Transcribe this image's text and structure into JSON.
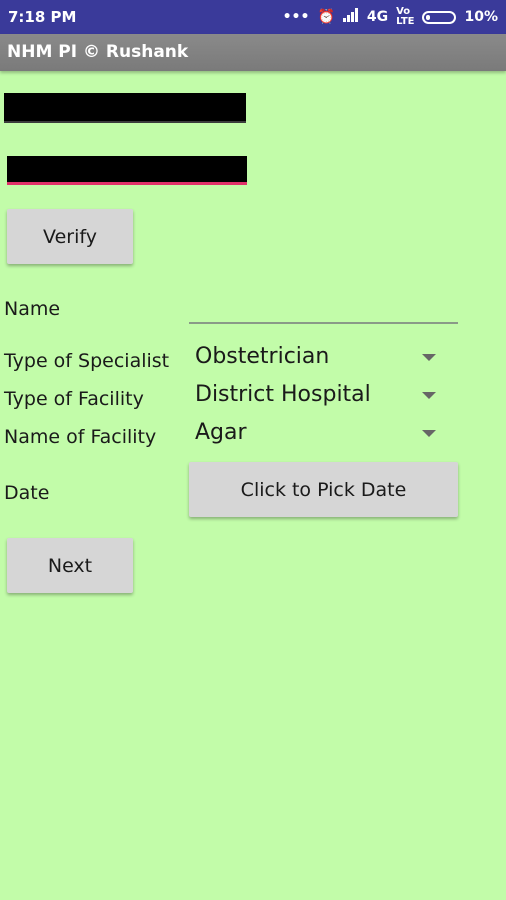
{
  "status_bar": {
    "time": "7:18 PM",
    "network": "4G",
    "battery": "10%"
  },
  "app_bar": {
    "title": "NHM PI © Rushank"
  },
  "form": {
    "verify_label": "Verify",
    "name_label": "Name",
    "name_value": "",
    "specialist_label": "Type of Specialist",
    "specialist_value": "Obstetrician",
    "facility_type_label": "Type of Facility",
    "facility_type_value": "District Hospital",
    "facility_name_label": "Name of Facility",
    "facility_name_value": "Agar",
    "date_label": "Date",
    "date_button": "Click to Pick Date",
    "next_label": "Next"
  },
  "colors": {
    "background": "#c2fca9",
    "status_bar": "#3a3a9a",
    "app_bar": "#808080",
    "accent": "#e0306a"
  },
  "icons": [
    "more-icon",
    "alarm-icon",
    "signal-icon",
    "volte-icon",
    "battery-icon",
    "dropdown-arrow-icon"
  ]
}
